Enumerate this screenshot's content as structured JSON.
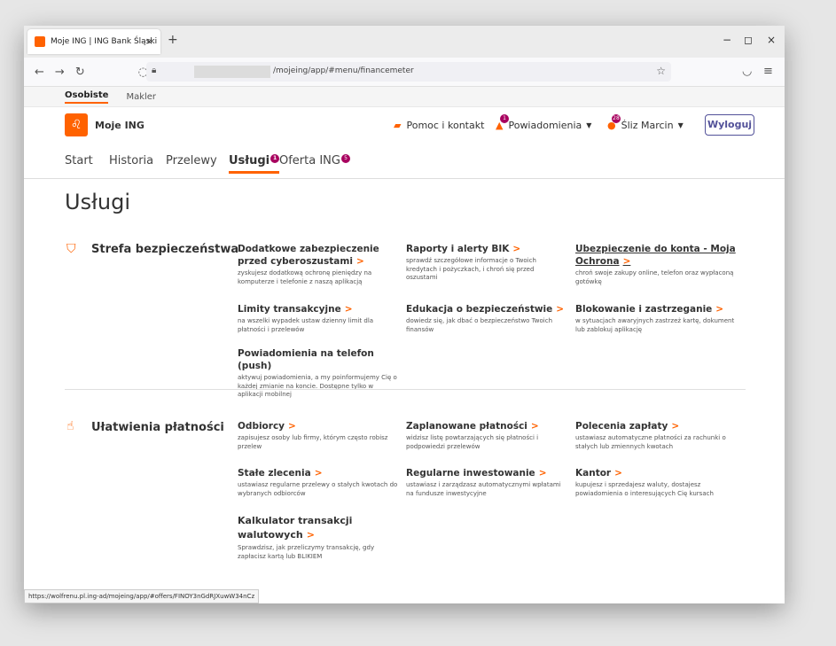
{
  "browser": {
    "tab_title": "Moje ING | ING Bank Śląski",
    "tab_close": "×",
    "new_tab": "+",
    "url": "/mojeing/app/#menu/financemeter",
    "win_min": "−",
    "win_max": "◻",
    "win_close": "×"
  },
  "site_tabs": [
    "Osobiste",
    "Makler"
  ],
  "header": {
    "logo_text": "Moje ING",
    "help": "Pomoc i kontakt",
    "notifications": "Powiadomienia",
    "notifications_badge": "1",
    "user": "Śliz Marcin",
    "user_badge": "28",
    "logout": "Wyloguj"
  },
  "mainnav": {
    "start": "Start",
    "historia": "Historia",
    "przelewy": "Przelewy",
    "uslugi": "Usługi",
    "uslugi_badge": "1",
    "oferta": "Oferta ING",
    "oferta_badge": "5"
  },
  "page": {
    "title": "Usługi"
  },
  "sections": [
    {
      "title": "Strefa bezpieczeństwa",
      "items": [
        {
          "title": "Dodatkowe zabezpieczenie przed cyberoszustami",
          "desc": "zyskujesz dodatkową ochronę pieniędzy na komputerze i telefonie z naszą aplikacją"
        },
        {
          "title": "Raporty i alerty BIK",
          "desc": "sprawdź szczegółowe informacje o Twoich kredytach i pożyczkach, i chroń się przed oszustami"
        },
        {
          "title": "Ubezpieczenie do konta - Moja Ochrona",
          "desc": "chroń swoje zakupy online, telefon oraz wypłaconą gotówkę"
        },
        {
          "title": "Limity transakcyjne",
          "desc": "na wszelki wypadek ustaw dzienny limit dla płatności i przelewów"
        },
        {
          "title": "Edukacja o bezpieczeństwie",
          "desc": "dowiedz się, jak dbać o bezpieczeństwo Twoich finansów"
        },
        {
          "title": "Blokowanie i zastrzeganie",
          "desc": "w sytuacjach awaryjnych zastrzeż kartę, dokument lub zablokuj aplikację"
        },
        {
          "title": "Powiadomienia na telefon (push)",
          "desc": "aktywuj powiadomienia, a my poinformujemy Cię o każdej zmianie na koncie. Dostępne tylko w aplikacji mobilnej"
        }
      ]
    },
    {
      "title": "Ułatwienia płatności",
      "items": [
        {
          "title": "Odbiorcy",
          "desc": "zapisujesz osoby lub firmy, którym często robisz przelew"
        },
        {
          "title": "Zaplanowane płatności",
          "desc": "widzisz listę powtarzających się płatności i podpowiedzi przelewów"
        },
        {
          "title": "Polecenia zapłaty",
          "desc": "ustawiasz automatyczne płatności za rachunki o stałych lub zmiennych kwotach"
        },
        {
          "title": "Stałe zlecenia",
          "desc": "ustawiasz regularne przelewy o stałych kwotach do wybranych odbiorców"
        },
        {
          "title": "Regularne inwestowanie",
          "desc": "ustawiasz i zarządzasz automatycznymi wpłatami na fundusze inwestycyjne"
        },
        {
          "title": "Kantor",
          "desc": "kupujesz i sprzedajesz waluty, dostajesz powiadomienia o interesujących Cię kursach"
        },
        {
          "title": "Kalkulator transakcji walutowych",
          "desc": "Sprawdzisz, jak przeliczymy transakcję, gdy zapłacisz kartą lub BLIKIEM"
        }
      ]
    }
  ],
  "chevron": ">",
  "status_url": "https://wolfrenu.pl.ing-ad/mojeing/app/#offers/FINOY3nGdRJXuwW34nCz"
}
